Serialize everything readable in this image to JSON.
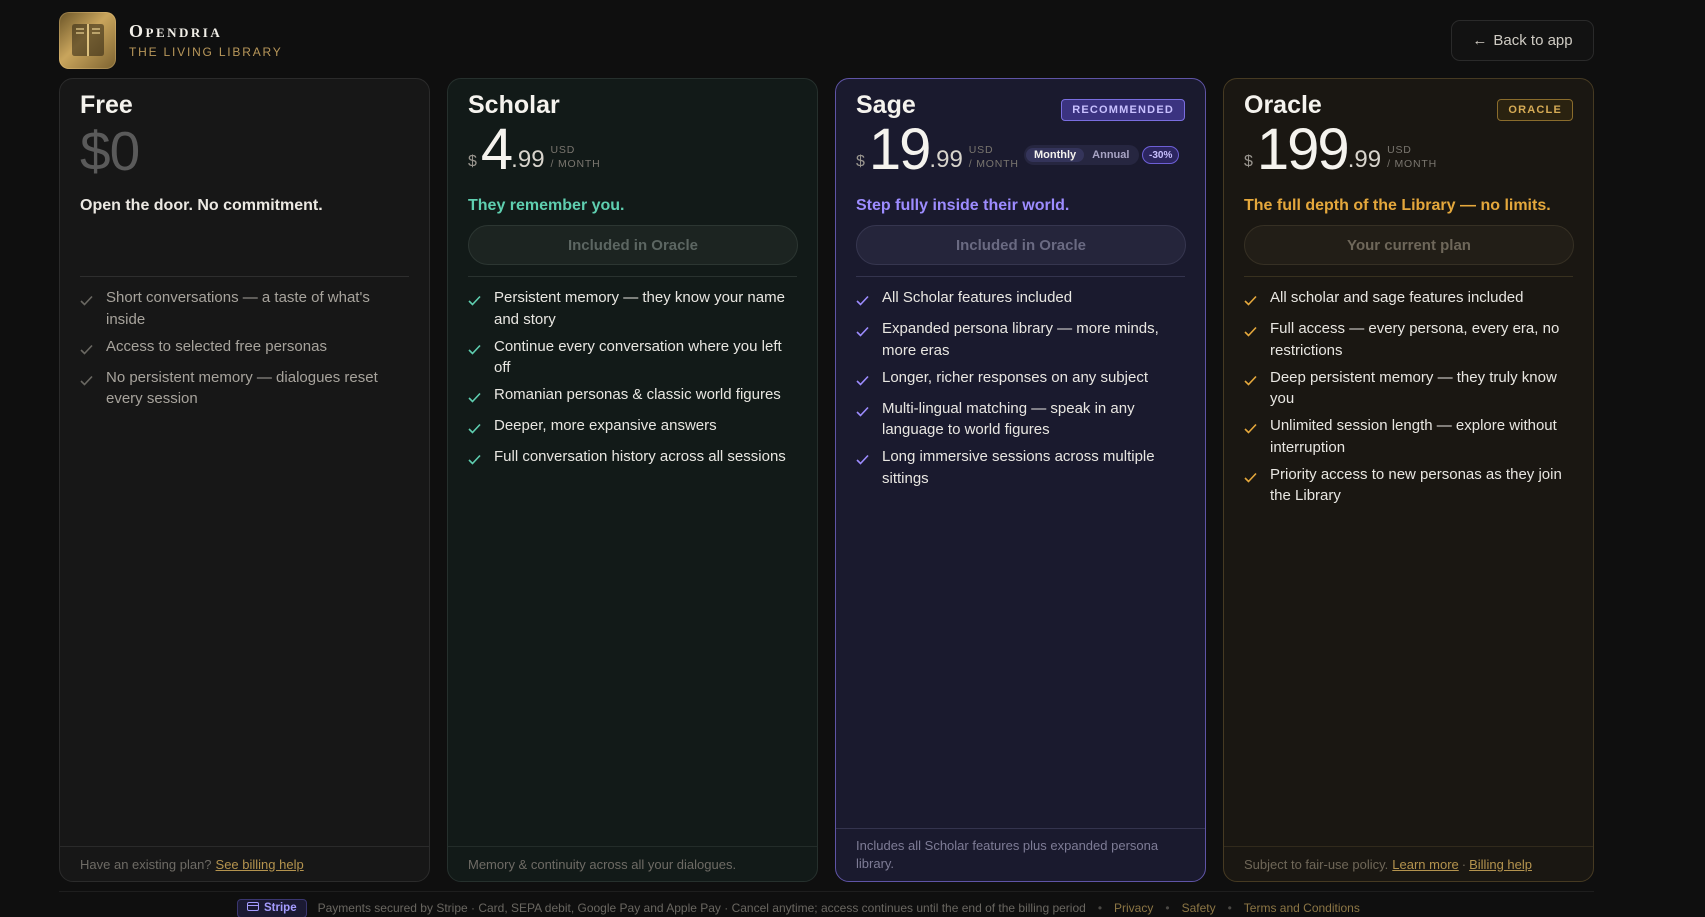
{
  "brand": {
    "name": "Opendria",
    "tagline": "THE LIVING LIBRARY"
  },
  "header": {
    "back_label": "Back to app"
  },
  "plans": [
    {
      "name": "Free",
      "price": "$0",
      "tagline": "Open the door. No commitment.",
      "features": [
        "Short conversations — a taste of what's inside",
        "Access to selected free personas",
        "No persistent memory — dialogues reset every session"
      ],
      "footer_text": "Have an existing plan?",
      "footer_link": "See billing help"
    },
    {
      "name": "Scholar",
      "currency": "$",
      "price_whole": "4",
      "price_cents": ".99",
      "unit_currency": "USD",
      "unit_period": "/ MONTH",
      "tagline": "They remember you.",
      "button": "Included in Oracle",
      "features": [
        "Persistent memory — they know your name and story",
        "Continue every conversation where you left off",
        "Romanian personas & classic world figures",
        "Deeper, more expansive answers",
        "Full conversation history across all sessions"
      ],
      "footer_text": "Memory & continuity across all your dialogues."
    },
    {
      "name": "Sage",
      "badge": "RECOMMENDED",
      "currency": "$",
      "price_whole": "19",
      "price_cents": ".99",
      "unit_currency": "USD",
      "unit_period": "/ MONTH",
      "toggle": {
        "monthly": "Monthly",
        "annual": "Annual",
        "selected": "Monthly"
      },
      "discount": "-30%",
      "tagline": "Step fully inside their world.",
      "button": "Included in Oracle",
      "features": [
        "All Scholar features included",
        "Expanded persona library — more minds, more eras",
        "Longer, richer responses on any subject",
        "Multi-lingual matching — speak in any language to world figures",
        "Long immersive sessions across multiple sittings"
      ],
      "footer_text": "Includes all Scholar features plus expanded persona library."
    },
    {
      "name": "Oracle",
      "badge": "ORACLE",
      "currency": "$",
      "price_whole": "199",
      "price_cents": ".99",
      "unit_currency": "USD",
      "unit_period": "/ MONTH",
      "tagline": "The full depth of the Library — no limits.",
      "button": "Your current plan",
      "features": [
        "All scholar and sage features included",
        "Full access — every persona, every era, no restrictions",
        "Deep persistent memory — they truly know you",
        "Unlimited session length — explore without interruption",
        "Priority access to new personas as they join the Library"
      ],
      "footer_text": "Subject to fair-use policy.",
      "footer_link1": "Learn more",
      "footer_sep": "·",
      "footer_link2": "Billing help"
    }
  ],
  "footer": {
    "stripe_label": "Stripe",
    "text": "Payments secured by Stripe · Card, SEPA debit, Google Pay and Apple Pay · Cancel anytime; access continues until the end of the billing period",
    "links": [
      "Privacy",
      "Safety",
      "Terms and Conditions"
    ]
  },
  "colors": {
    "background": "#0f0f0f",
    "scholar_accent": "#5fcfb0",
    "sage_accent": "#9d8cff",
    "oracle_accent": "#e5a83c",
    "brand_gold": "#b8975a"
  }
}
